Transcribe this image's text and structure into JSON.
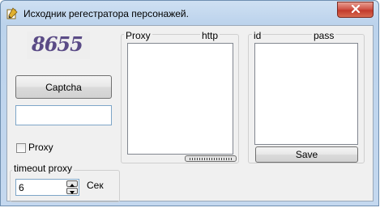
{
  "window": {
    "title": "Исходник регестратора персонажей.",
    "close_icon": "close-icon"
  },
  "captcha": {
    "image_text": "8655",
    "button_label": "Captcha",
    "input_value": ""
  },
  "proxy_checkbox": {
    "label": "Proxy",
    "checked": false
  },
  "timeout": {
    "group_label": "timeout proxy",
    "value": "6",
    "unit_label": "Сек"
  },
  "proxy_panel": {
    "col1": "Proxy",
    "col2": "http",
    "items": []
  },
  "id_panel": {
    "col1": "id",
    "col2": "pass",
    "items": [],
    "save_label": "Save"
  },
  "colors": {
    "title_bar": "#bcd3ec",
    "close_button": "#c23a2c",
    "client_bg": "#f0f0f0",
    "captcha_text": "#5a4b86"
  }
}
